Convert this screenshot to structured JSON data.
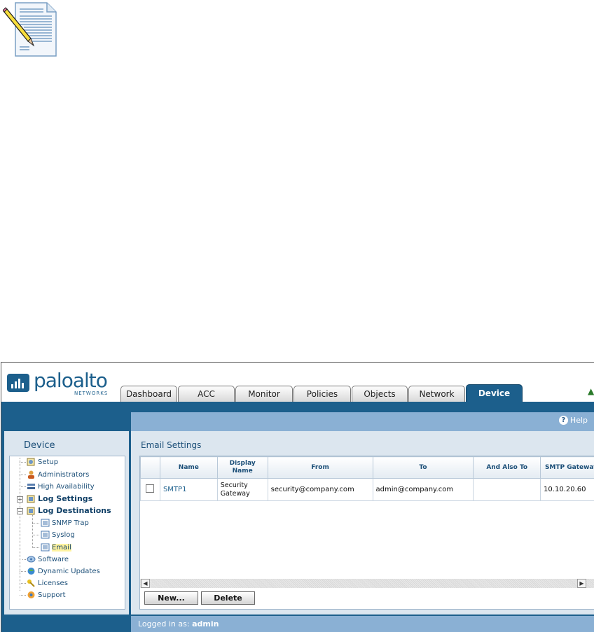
{
  "header": {
    "logo_text": "paloalto",
    "logo_subtext": "NETWORKS",
    "tabs": [
      {
        "label": "Dashboard"
      },
      {
        "label": "ACC"
      },
      {
        "label": "Monitor"
      },
      {
        "label": "Policies"
      },
      {
        "label": "Objects"
      },
      {
        "label": "Network"
      },
      {
        "label": "Device"
      }
    ],
    "active_tab": "Device"
  },
  "helpbar": {
    "help_label": "Help"
  },
  "sidebar": {
    "title": "Device",
    "items": [
      {
        "label": "Setup",
        "icon": "setup-icon"
      },
      {
        "label": "Administrators",
        "icon": "administrators-icon"
      },
      {
        "label": "High Availability",
        "icon": "high-availability-icon"
      },
      {
        "label": "Log Settings",
        "icon": "log-settings-icon"
      },
      {
        "label": "Log Destinations",
        "icon": "log-destinations-icon"
      },
      {
        "label": "SNMP Trap",
        "icon": "snmp-trap-icon"
      },
      {
        "label": "Syslog",
        "icon": "syslog-icon"
      },
      {
        "label": "Email",
        "icon": "email-icon"
      },
      {
        "label": "Software",
        "icon": "software-icon"
      },
      {
        "label": "Dynamic Updates",
        "icon": "dynamic-updates-icon"
      },
      {
        "label": "Licenses",
        "icon": "licenses-icon"
      },
      {
        "label": "Support",
        "icon": "support-icon"
      }
    ],
    "selected": "Email"
  },
  "main": {
    "title": "Email Settings",
    "columns": [
      {
        "label": ""
      },
      {
        "label": "Name"
      },
      {
        "label": "Display Name"
      },
      {
        "label": "From"
      },
      {
        "label": "To"
      },
      {
        "label": "And Also To"
      },
      {
        "label": "SMTP Gateway"
      }
    ],
    "rows": [
      {
        "name": "SMTP1",
        "display_name": "Security Gateway",
        "from": "security@company.com",
        "to": "admin@company.com",
        "also_to": "",
        "smtp_gateway": "10.10.20.60"
      }
    ],
    "buttons": {
      "new_label": "New...",
      "delete_label": "Delete"
    }
  },
  "footer": {
    "logged_in_prefix": "Logged in as:",
    "user": "admin"
  }
}
